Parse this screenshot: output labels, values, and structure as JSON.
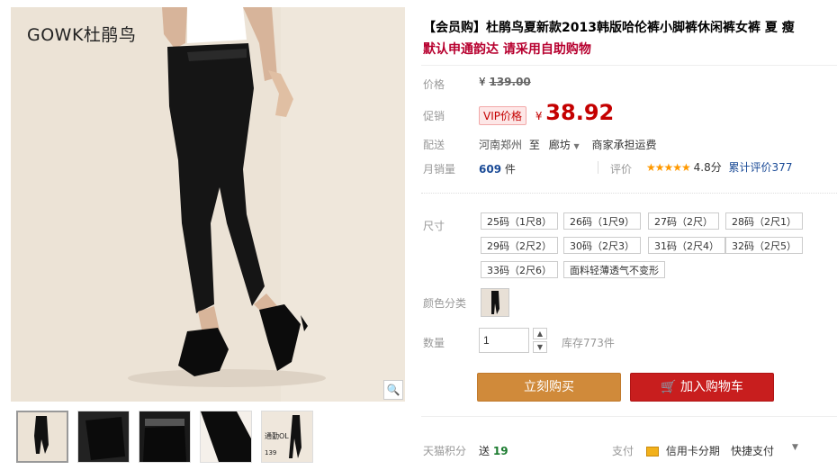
{
  "gallery": {
    "brand_logo_text": "GOWK杜鹃鸟",
    "zoom_icon": "magnifier-icon",
    "thumbnails": [
      {
        "name": "thumb-1"
      },
      {
        "name": "thumb-2"
      },
      {
        "name": "thumb-3"
      },
      {
        "name": "thumb-4"
      },
      {
        "name": "thumb-5",
        "text1": "通勤OL",
        "text2": "139"
      }
    ]
  },
  "product": {
    "title": "【会员购】杜鹃鸟夏新款2013韩版哈伦裤小脚裤休闲裤女裤 夏 瘦",
    "subtitle": "默认申通韵达 请采用自助购物"
  },
  "price": {
    "label": "价格",
    "currency": "¥",
    "original": "139.00"
  },
  "promo": {
    "label": "促销",
    "badge": "VIP价格",
    "currency": "¥",
    "price": "38.92"
  },
  "shipping": {
    "label": "配送",
    "from": "河南郑州",
    "to_word": "至",
    "dest": "廊坊",
    "fee": "商家承担运费"
  },
  "sales": {
    "label": "月销量",
    "count": "609",
    "unit": "件",
    "rating_label": "评价",
    "stars": "★★★★★",
    "score": "4.8分",
    "reviews": "累计评价377"
  },
  "sizes": {
    "label": "尺寸",
    "options": [
      "25码（1尺8）",
      "26码（1尺9）",
      "27码（2尺）",
      "28码（2尺1）",
      "29码（2尺2）",
      "30码（2尺3）",
      "31码（2尺4）",
      "32码（2尺5）",
      "33码（2尺6）",
      "面料轻薄透气不变形"
    ]
  },
  "color": {
    "label": "颜色分类"
  },
  "quantity": {
    "label": "数量",
    "value": "1",
    "up": "▲",
    "down": "▼",
    "stock": "库存773件"
  },
  "buttons": {
    "buy_now": "立刻购买",
    "add_cart": "加入购物车",
    "cart_icon": "cart-icon"
  },
  "footer": {
    "points_label": "天猫积分",
    "points_prefix": "送",
    "points": "19",
    "pay_label": "支付",
    "card": "信用卡分期",
    "quick": "快捷支付",
    "more_icon": "chevron-down-icon"
  },
  "colors": {
    "accent_red": "#c40000",
    "buy_orange": "#d08a3a",
    "cart_red": "#c81e1e",
    "link_blue": "#1b4b97"
  }
}
